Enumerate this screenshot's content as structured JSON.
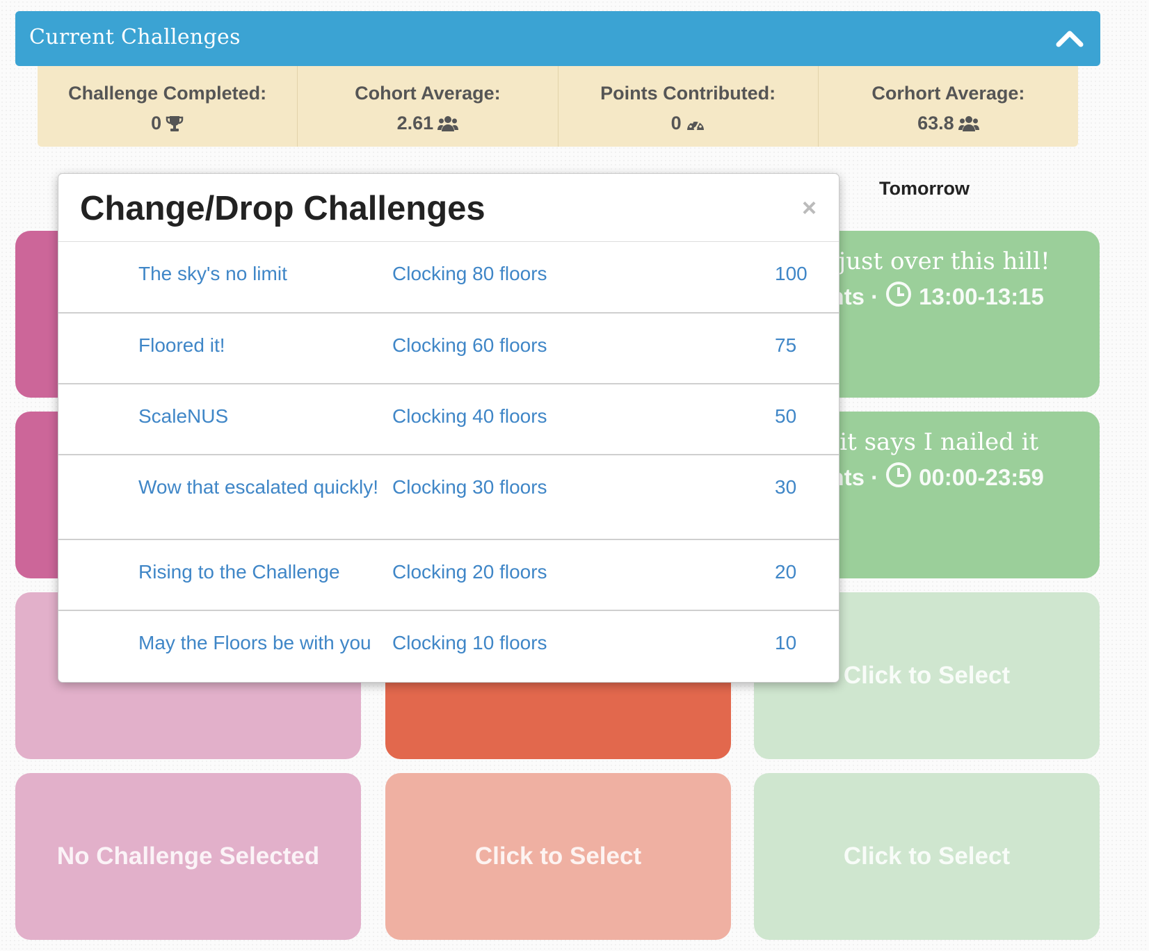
{
  "header": {
    "title": "Current Challenges",
    "collapse_icon": "chevron-up-icon"
  },
  "stats": [
    {
      "label": "Challenge Completed:",
      "value": "0",
      "icon": "trophy-icon"
    },
    {
      "label": "Cohort Average:",
      "value": "2.61",
      "icon": "users-icon"
    },
    {
      "label": "Points Contributed:",
      "value": "0",
      "icon": "dashboard-icon"
    },
    {
      "label": "Corhort Average:",
      "value": "63.8",
      "icon": "users-icon"
    }
  ],
  "columns": {
    "tomorrow": "Tomorrow"
  },
  "tiles": {
    "green_1": {
      "title": "ay just over this hill!",
      "meta_prefix": "oints ·",
      "time": "13:00-13:15",
      "icon": "clock-icon"
    },
    "green_2": {
      "title": "tbit says I nailed it",
      "meta_prefix": "oints ·",
      "time": "00:00-23:59",
      "icon": "clock-icon"
    },
    "green_3": {
      "label": "Click to Select"
    },
    "pink_4": {
      "label": "No Challenge Selected"
    },
    "red_4": {
      "label": "Click to Select"
    },
    "green_4": {
      "label": "Click to Select"
    }
  },
  "modal": {
    "title": "Change/Drop Challenges",
    "close_label": "×",
    "rows": [
      {
        "name": "The sky's no limit",
        "desc": "Clocking 80 floors",
        "points": "100"
      },
      {
        "name": "Floored it!",
        "desc": "Clocking 60 floors",
        "points": "75"
      },
      {
        "name": "ScaleNUS",
        "desc": "Clocking 40 floors",
        "points": "50"
      },
      {
        "name": "Wow that escalated quickly!",
        "desc": "Clocking 30 floors",
        "points": "30"
      },
      {
        "name": "Rising to the Challenge",
        "desc": "Clocking 20 floors",
        "points": "20"
      },
      {
        "name": "May the Floors be with you",
        "desc": "Clocking 10 floors",
        "points": "10"
      }
    ]
  },
  "colors": {
    "header_blue": "#3ba3d3",
    "stats_bg": "#f5e8c6",
    "pink": "#cc6699",
    "red": "#e2684d",
    "green": "#9bcf9a",
    "link_blue": "#3f86c7"
  }
}
